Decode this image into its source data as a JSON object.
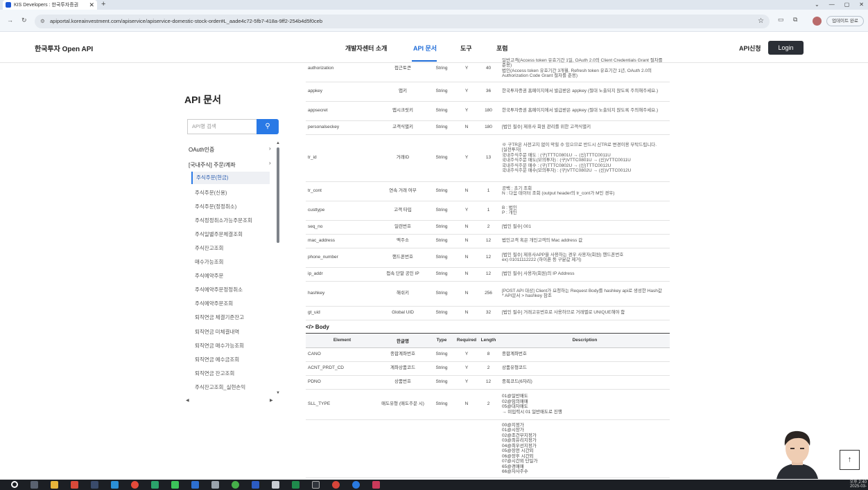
{
  "browser": {
    "tab_title": "KIS Developers : 한국투자증권",
    "url": "apiportal.koreainvestment.com/apiservice/apiservice-domestic-stock-order#L_aade4c72-5fb7-418a-9ff2-254b4d5f0ceb",
    "update_label": "업데이트 완료"
  },
  "header": {
    "logo": "한국투자 Open API",
    "menu": [
      "개발자센터 소개",
      "API 문서",
      "도구",
      "포럼"
    ],
    "api_request": "API신청",
    "login": "Login"
  },
  "sidebar": {
    "page_title": "API 문서",
    "search_placeholder": "API명 검색",
    "groups": [
      "OAuth인증",
      "[국내주식] 주문/계좌"
    ],
    "items": [
      "주식주문(현금)",
      "주식주문(신용)",
      "주식주문(정정취소)",
      "주식정정취소가능주문조회",
      "주식일별주문체결조회",
      "주식잔고조회",
      "매수가능조회",
      "주식예약주문",
      "주식예약주문정정취소",
      "주식예약주문조회",
      "퇴직연금 체결기준잔고",
      "퇴직연금 미체결내역",
      "퇴직연금 매수가능조회",
      "퇴직연금 예수금조회",
      "퇴직연금 잔고조회",
      "주식잔고조회_실현손익"
    ]
  },
  "params": [
    {
      "element": "authorization",
      "name": "접근토큰",
      "type": "String",
      "req": "Y",
      "len": "40",
      "desc": [
        "일반고객(Access token 유효기간 1일, OAuth 2.0의 Client Credentials Grant 절차를 준용)",
        "법인(Access token 유효기간 3개월, Refresh token 유효기간 1년, OAuth 2.0의 Authorization Code Grant 절차를 준용)"
      ]
    },
    {
      "element": "appkey",
      "name": "앱키",
      "type": "String",
      "req": "Y",
      "len": "36",
      "desc": [
        "한국투자증권 홈페이지에서 발급받은 appkey (절대 노출되지 않도록 주의해주세요.)"
      ]
    },
    {
      "element": "appsecret",
      "name": "앱시크릿키",
      "type": "String",
      "req": "Y",
      "len": "180",
      "desc": [
        "한국투자증권 홈페이지에서 발급받은 appkey (절대 노출되지 않도록 주의해주세요.)"
      ]
    },
    {
      "element": "personalseckey",
      "name": "고객식별키",
      "type": "String",
      "req": "N",
      "len": "180",
      "desc": [
        "[법인 필수] 제휴사 회원 관리를 위한 고객식별키"
      ]
    },
    {
      "element": "tr_id",
      "name": "거래ID",
      "type": "String",
      "req": "Y",
      "len": "13",
      "desc": [
        "※ 구TR은 사전고지 없이 막힐 수 있으므로 반드시 신TR로 변경이용 부탁드립니다.",
        "[실전투자]",
        "국내주식주문 매도 : (구)TTTC0801U → (신)TTTC0011U",
        "국내주식주문 매도(모의투자) : (구)VTTC0801U → (신)VTTC0011U",
        "국내주식주문 매수 : (구)TTTC0802U → (신)TTTC0012U",
        "국내주식주문 매수(모의투자) : (구)VTTC0802U → (신)VTTC0012U"
      ]
    },
    {
      "element": "tr_cont",
      "name": "연속 거래 여부",
      "type": "String",
      "req": "N",
      "len": "1",
      "desc": [
        "공백 : 초기 조회",
        "N : 다음 데이터 조회 (output header의 tr_cont가 M인 경우)"
      ]
    },
    {
      "element": "custtype",
      "name": "고객 타입",
      "type": "String",
      "req": "Y",
      "len": "1",
      "desc": [
        "B : 법인",
        "P : 개인"
      ]
    },
    {
      "element": "seq_no",
      "name": "일련번호",
      "type": "String",
      "req": "N",
      "len": "2",
      "desc": [
        "[법인 필수] 001"
      ]
    },
    {
      "element": "mac_address",
      "name": "맥주소",
      "type": "String",
      "req": "N",
      "len": "12",
      "desc": [
        "법인고객 혹은 개인고객의 Mac address 값"
      ]
    },
    {
      "element": "phone_number",
      "name": "핸드폰번호",
      "type": "String",
      "req": "N",
      "len": "12",
      "desc": [
        "[법인 필수] 제휴사APP을 사용하는 경우 사용자(회원) 핸드폰번호",
        "ex) 01011112222 (하이픈 등 구분값 제거)"
      ]
    },
    {
      "element": "ip_addr",
      "name": "접속 단말 공인 IP",
      "type": "String",
      "req": "N",
      "len": "12",
      "desc": [
        "[법인 필수] 사용자(회원)의 IP Address"
      ]
    },
    {
      "element": "hashkey",
      "name": "해쉬키",
      "type": "String",
      "req": "N",
      "len": "256",
      "desc": [
        "[POST API 대상] Client가 요청하는 Request Body를 hashkey api로 생성한 Hash값",
        "* API문서 > hashkey 참조"
      ]
    },
    {
      "element": "gt_uid",
      "name": "Global UID",
      "type": "String",
      "req": "N",
      "len": "32",
      "desc": [
        "[법인 필수] 거래고유번호로 사용하므로 거래별로 UNIQUE해야 함"
      ]
    }
  ],
  "body": {
    "title": "Body",
    "headers": [
      "Element",
      "한글명",
      "Type",
      "Required",
      "Length",
      "Description"
    ],
    "rows": [
      {
        "element": "CANO",
        "name": "종합계좌번호",
        "type": "String",
        "req": "Y",
        "len": "8",
        "desc": [
          "종합계좌번호"
        ]
      },
      {
        "element": "ACNT_PRDT_CD",
        "name": "계좌상품코드",
        "type": "String",
        "req": "Y",
        "len": "2",
        "desc": [
          "상품유형코드"
        ]
      },
      {
        "element": "PDNO",
        "name": "상품번호",
        "type": "String",
        "req": "Y",
        "len": "12",
        "desc": [
          "종목코드(6자리)"
        ]
      },
      {
        "element": "SLL_TYPE",
        "name": "매도유형 (매도주문 시)",
        "type": "String",
        "req": "N",
        "len": "2",
        "desc": [
          "01@일반매도",
          "02@임의매매",
          "05@대차매도",
          "→ 미입력시 01 일반매도로 진행"
        ]
      },
      {
        "element": "",
        "name": "",
        "type": "",
        "req": "",
        "len": "",
        "desc": [
          "00@지정가",
          "01@시장가",
          "02@조건부지정가",
          "03@최유리지정가",
          "04@최우선지정가",
          "05@장전 시간외",
          "06@장후 시간외",
          "07@시간외 단일가",
          "65@경매매",
          "66@자사주수"
        ]
      }
    ]
  },
  "clock": {
    "line1": "오후 2:40",
    "line2": "2025-03-"
  }
}
